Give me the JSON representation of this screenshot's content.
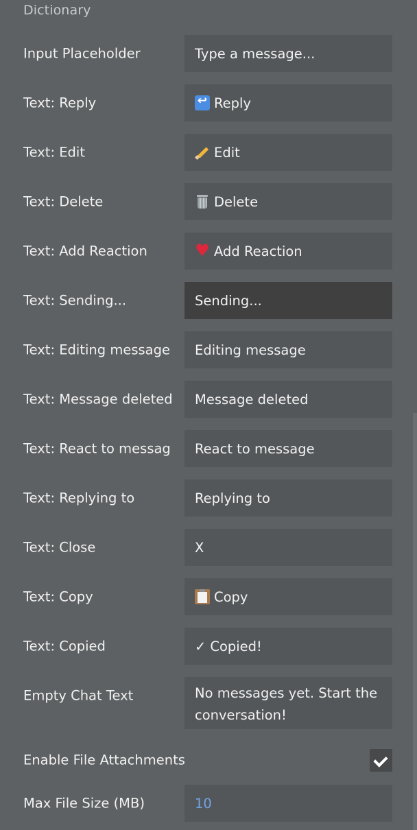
{
  "section": {
    "title": "Dictionary"
  },
  "rows": [
    {
      "label": "Input Placeholder",
      "value": "Type a message...",
      "icon": null
    },
    {
      "label": "Text: Reply",
      "value": "Reply",
      "icon": "reply-emoji-icon"
    },
    {
      "label": "Text: Edit",
      "value": "Edit",
      "icon": "pencil-emoji-icon"
    },
    {
      "label": "Text: Delete",
      "value": "Delete",
      "icon": "wastebasket-emoji-icon"
    },
    {
      "label": "Text: Add Reaction",
      "value": "Add Reaction",
      "icon": "heart-emoji-icon"
    },
    {
      "label": "Text: Sending...",
      "value": "Sending...",
      "icon": null,
      "focused": true
    },
    {
      "label": "Text: Editing message",
      "value": "Editing message",
      "icon": null
    },
    {
      "label": "Text: Message deleted",
      "value": "Message deleted",
      "icon": null
    },
    {
      "label": "Text: React to messag",
      "value": "React to message",
      "icon": null
    },
    {
      "label": "Text: Replying to",
      "value": "Replying to",
      "icon": null
    },
    {
      "label": "Text: Close",
      "value": "X",
      "icon": null
    },
    {
      "label": "Text: Copy",
      "value": "Copy",
      "icon": "clipboard-emoji-icon"
    },
    {
      "label": "Text: Copied",
      "value": "Copied!",
      "icon": "check-mark-icon",
      "prefix": "✓"
    },
    {
      "label": "Empty Chat Text",
      "value": "No messages yet. Start the conversation!",
      "icon": null
    }
  ],
  "file_attachments": {
    "label": "Enable File Attachments",
    "checked": true
  },
  "max_file_size": {
    "label": "Max File Size (MB)",
    "value": "10"
  },
  "colors": {
    "background": "#5e6163",
    "field": "#54575a",
    "field_focused": "#404040",
    "number_accent": "#6fa4e6"
  }
}
